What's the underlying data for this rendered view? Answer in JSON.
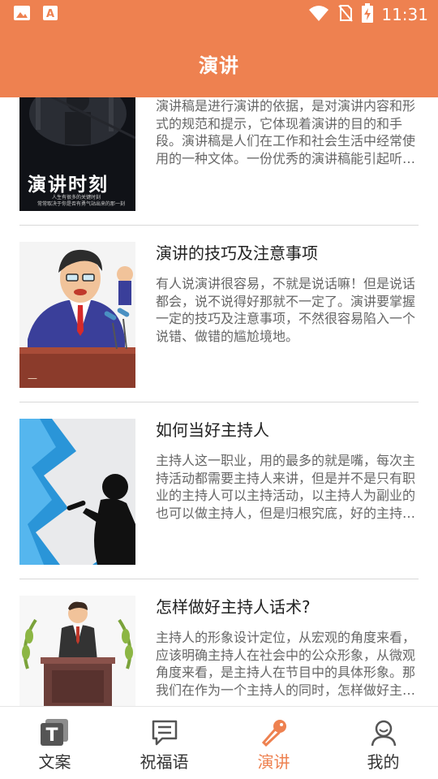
{
  "status": {
    "time": "11:31",
    "icons": [
      "image-icon",
      "font-a-icon",
      "wifi-icon",
      "no-sim-icon",
      "battery-charging-icon"
    ]
  },
  "header": {
    "title": "演讲"
  },
  "colors": {
    "accent": "#ee8150",
    "title_text": "#222222",
    "desc_text": "#666666",
    "divider": "#d9d9d9"
  },
  "articles": [
    {
      "title": "",
      "description": "演讲稿是进行演讲的依据，是对演讲内容和形式的规范和提示，它体现着演讲的目的和手段。演讲稿是人们在工作和社会生活中经常使用的一种文体。一份优秀的演讲稿能引起听众的共鸣，小编收集了优...",
      "thumb_text": "演讲时刻",
      "thumb_subtext_1": "人生有很多的关键时刻",
      "thumb_subtext_2": "常常取决于你是否有勇气站出来的那一刻"
    },
    {
      "title": "演讲的技巧及注意事项",
      "description": "有人说演讲很容易，不就是说话嘛！但是说话都会，说不说得好那就不一定了。演讲要掌握一定的技巧及注意事项，不然很容易陷入一个说错、做错的尴尬境地。"
    },
    {
      "title": "如何当好主持人",
      "description": "主持人这一职业，用的最多的就是嘴，每次主持活动都需要主持人来讲，但是并不是只有职业的主持人可以主持活动，以主持人为副业的也可以做主持人，但是归根究底，好的主持人带来的是欢乐，那么..."
    },
    {
      "title": "怎样做好主持人话术?",
      "description": "主持人的形象设计定位，从宏观的角度来看，应该明确主持人在社会中的公众形象，从微观角度来看，是主持人在节目中的具体形象。那我们在作为一个主持人的同时，怎样做好主持人话术呢?"
    }
  ],
  "bottom_nav": {
    "items": [
      {
        "label": "文案",
        "icon": "text-t-icon"
      },
      {
        "label": "祝福语",
        "icon": "message-icon"
      },
      {
        "label": "演讲",
        "icon": "microphone-icon"
      },
      {
        "label": "我的",
        "icon": "user-icon"
      }
    ],
    "active_index": 2
  }
}
